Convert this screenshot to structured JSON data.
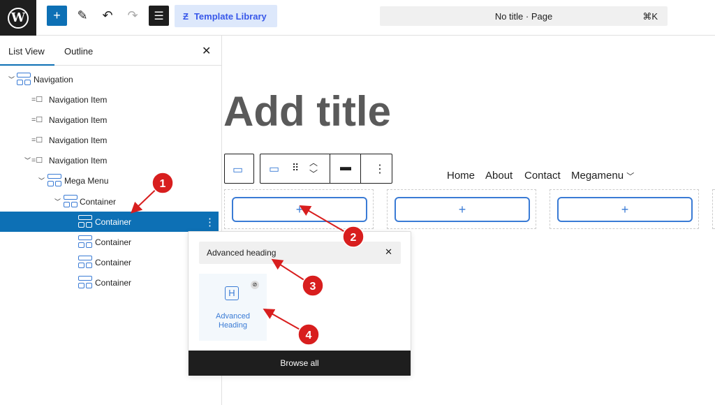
{
  "topbar": {
    "template_library": "Template Library",
    "document_title": "No title · Page",
    "shortcut": "⌘K"
  },
  "sidebar": {
    "tabs": [
      "List View",
      "Outline"
    ],
    "tree": [
      {
        "label": "Navigation"
      },
      {
        "label": "Navigation Item"
      },
      {
        "label": "Navigation Item"
      },
      {
        "label": "Navigation Item"
      },
      {
        "label": "Navigation Item"
      },
      {
        "label": "Mega Menu"
      },
      {
        "label": "Container"
      },
      {
        "label": "Container",
        "selected": true
      },
      {
        "label": "Container"
      },
      {
        "label": "Container"
      },
      {
        "label": "Container"
      }
    ]
  },
  "canvas": {
    "title_placeholder": "Add title",
    "nav_links": [
      "Home",
      "About",
      "Contact",
      "Megamenu"
    ]
  },
  "inserter": {
    "search_value": "Advanced heading",
    "result": "Advanced Heading",
    "browse_all": "Browse all"
  },
  "annotations": [
    "1",
    "2",
    "3",
    "4"
  ],
  "colors": {
    "accent": "#0d70b5",
    "annotation": "#d81e1e",
    "template_library": "#3858e9"
  }
}
